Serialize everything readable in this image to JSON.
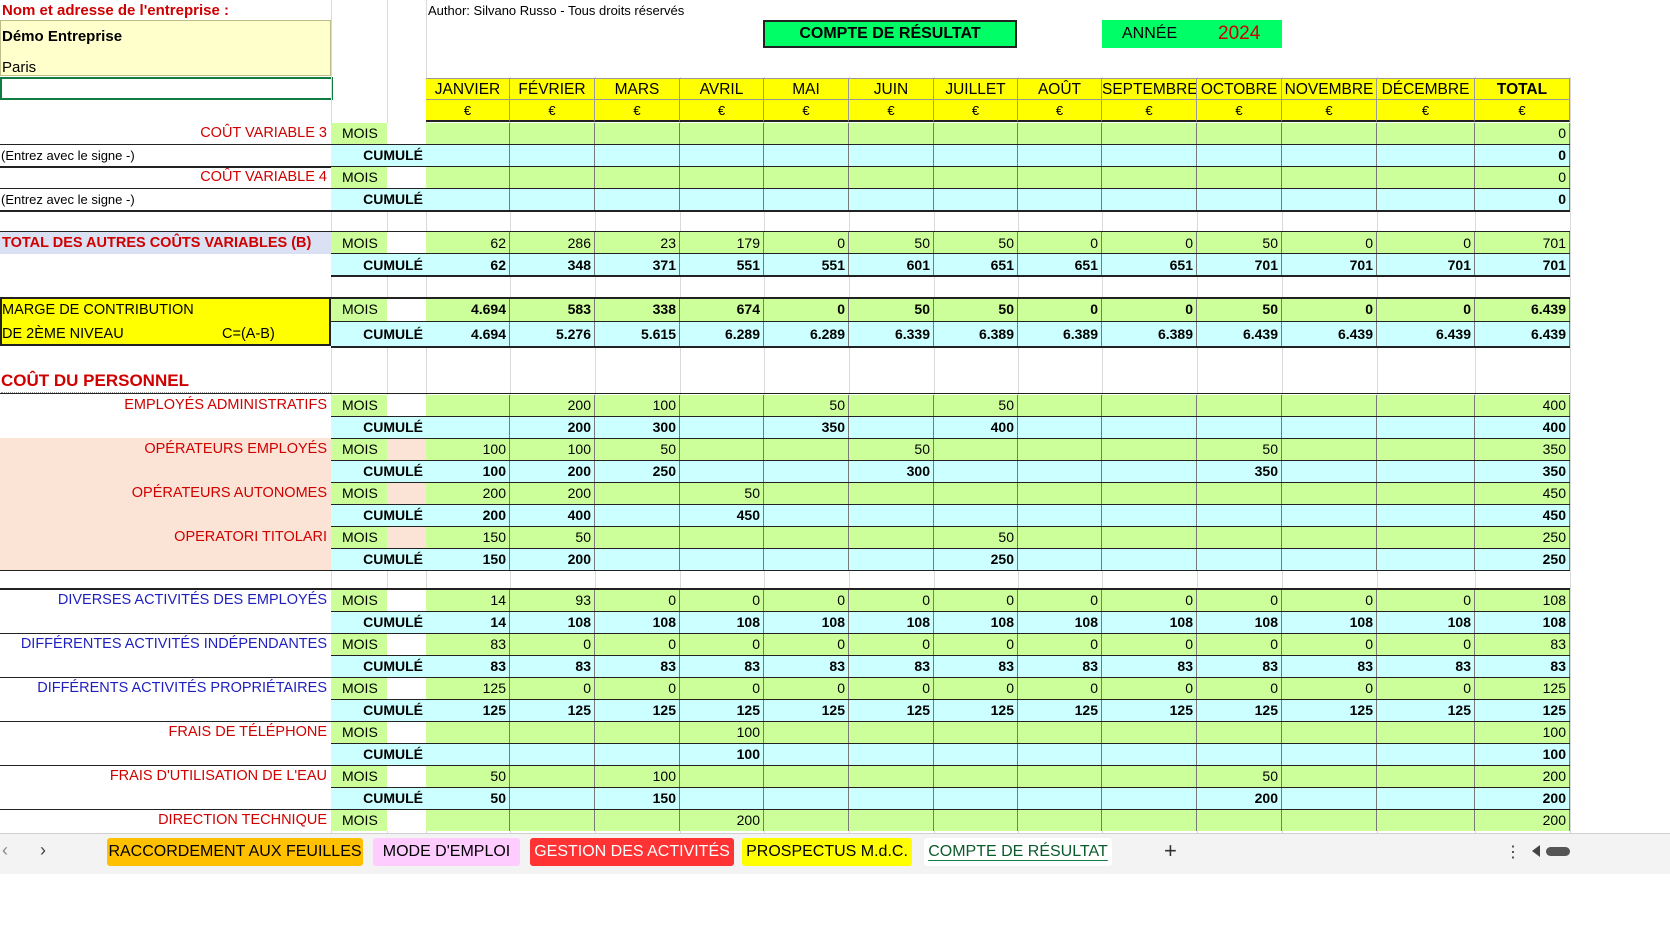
{
  "company": {
    "header": "Nom et adresse de l'entreprise :",
    "name": "Démo Entreprise",
    "city": "Paris"
  },
  "author": "Author: Silvano Russo - Tous droits réservés",
  "title": "COMPTE DE RÉSULTAT",
  "year_label": "ANNÉE",
  "year": "2024",
  "months": [
    "JANVIER",
    "FÉVRIER",
    "MARS",
    "AVRIL",
    "MAI",
    "JUIN",
    "JUILLET",
    "AOÛT",
    "SEPTEMBRE",
    "OCTOBRE",
    "NOVEMBRE",
    "DÉCEMBRE",
    "TOTAL"
  ],
  "currency": "€",
  "lbl_mois": "MOIS",
  "lbl_cumule": "CUMULÉ",
  "rows": {
    "cv3": {
      "label": "COÛT VARIABLE 3",
      "note": "(Entrez avec le signe -)",
      "mois": [
        "",
        "",
        "",
        "",
        "",
        "",
        "",
        "",
        "",
        "",
        "",
        "",
        "0"
      ],
      "cumule": [
        "",
        "",
        "",
        "",
        "",
        "",
        "",
        "",
        "",
        "",
        "",
        "",
        "0"
      ]
    },
    "cv4": {
      "label": "COÛT VARIABLE 4",
      "note": "(Entrez avec le signe -)",
      "mois": [
        "",
        "",
        "",
        "",
        "",
        "",
        "",
        "",
        "",
        "",
        "",
        "",
        "0"
      ],
      "cumule": [
        "",
        "",
        "",
        "",
        "",
        "",
        "",
        "",
        "",
        "",
        "",
        "",
        "0"
      ]
    },
    "tot": {
      "label": "TOTAL DES AUTRES COÛTS VARIABLES (B)",
      "mois": [
        "62",
        "286",
        "23",
        "179",
        "0",
        "50",
        "50",
        "0",
        "0",
        "50",
        "0",
        "0",
        "701"
      ],
      "cumule": [
        "62",
        "348",
        "371",
        "551",
        "551",
        "601",
        "651",
        "651",
        "651",
        "701",
        "701",
        "701",
        "701"
      ]
    },
    "marge": {
      "label1": "MARGE DE CONTRIBUTION",
      "label2": "DE 2ÈME NIVEAU",
      "formula": "C=(A-B)",
      "mois": [
        "4.694",
        "583",
        "338",
        "674",
        "0",
        "50",
        "50",
        "0",
        "0",
        "50",
        "0",
        "0",
        "6.439"
      ],
      "cumule": [
        "4.694",
        "5.276",
        "5.615",
        "6.289",
        "6.289",
        "6.339",
        "6.389",
        "6.389",
        "6.389",
        "6.439",
        "6.439",
        "6.439",
        "6.439"
      ]
    },
    "personnel_title": "COÛT DU PERSONNEL",
    "emp_admin": {
      "label": "EMPLOYÉS ADMINISTRATIFS",
      "mois": [
        "",
        "200",
        "100",
        "",
        "50",
        "",
        "50",
        "",
        "",
        "",
        "",
        "",
        "400"
      ],
      "cumule": [
        "",
        "200",
        "300",
        "",
        "350",
        "",
        "400",
        "",
        "",
        "",
        "",
        "",
        "400"
      ]
    },
    "op_emp": {
      "label": "OPÉRATEURS EMPLOYÉS",
      "mois": [
        "100",
        "100",
        "50",
        "",
        "",
        "50",
        "",
        "",
        "",
        "50",
        "",
        "",
        "350"
      ],
      "cumule": [
        "100",
        "200",
        "250",
        "",
        "",
        "300",
        "",
        "",
        "",
        "350",
        "",
        "",
        "350"
      ]
    },
    "op_auto": {
      "label": "OPÉRATEURS AUTONOMES",
      "mois": [
        "200",
        "200",
        "",
        "50",
        "",
        "",
        "",
        "",
        "",
        "",
        "",
        "",
        "450"
      ],
      "cumule": [
        "200",
        "400",
        "",
        "450",
        "",
        "",
        "",
        "",
        "",
        "",
        "",
        "",
        "450"
      ]
    },
    "op_tit": {
      "label": "OPERATORI TITOLARI",
      "mois": [
        "150",
        "50",
        "",
        "",
        "",
        "",
        "50",
        "",
        "",
        "",
        "",
        "",
        "250"
      ],
      "cumule": [
        "150",
        "200",
        "",
        "",
        "",
        "",
        "250",
        "",
        "",
        "",
        "",
        "",
        "250"
      ]
    },
    "div_emp": {
      "label": "DIVERSES ACTIVITÉS DES EMPLOYÉS",
      "mois": [
        "14",
        "93",
        "0",
        "0",
        "0",
        "0",
        "0",
        "0",
        "0",
        "0",
        "0",
        "0",
        "108"
      ],
      "cumule": [
        "14",
        "108",
        "108",
        "108",
        "108",
        "108",
        "108",
        "108",
        "108",
        "108",
        "108",
        "108",
        "108"
      ]
    },
    "diff_ind": {
      "label": "DIFFÉRENTES ACTIVITÉS INDÉPENDANTES",
      "mois": [
        "83",
        "0",
        "0",
        "0",
        "0",
        "0",
        "0",
        "0",
        "0",
        "0",
        "0",
        "0",
        "83"
      ],
      "cumule": [
        "83",
        "83",
        "83",
        "83",
        "83",
        "83",
        "83",
        "83",
        "83",
        "83",
        "83",
        "83",
        "83"
      ]
    },
    "diff_prop": {
      "label": "DIFFÉRENTS ACTIVITÉS PROPRIÉTAIRES",
      "mois": [
        "125",
        "0",
        "0",
        "0",
        "0",
        "0",
        "0",
        "0",
        "0",
        "0",
        "0",
        "0",
        "125"
      ],
      "cumule": [
        "125",
        "125",
        "125",
        "125",
        "125",
        "125",
        "125",
        "125",
        "125",
        "125",
        "125",
        "125",
        "125"
      ]
    },
    "tel": {
      "label": "FRAIS DE TÉLÉPHONE",
      "mois": [
        "",
        "",
        "",
        "100",
        "",
        "",
        "",
        "",
        "",
        "",
        "",
        "",
        "100"
      ],
      "cumule": [
        "",
        "",
        "",
        "100",
        "",
        "",
        "",
        "",
        "",
        "",
        "",
        "",
        "100"
      ]
    },
    "eau": {
      "label": "FRAIS D'UTILISATION DE L'EAU",
      "mois": [
        "50",
        "",
        "100",
        "",
        "",
        "",
        "",
        "",
        "",
        "50",
        "",
        "",
        "200"
      ],
      "cumule": [
        "50",
        "",
        "150",
        "",
        "",
        "",
        "",
        "",
        "",
        "200",
        "",
        "",
        "200"
      ]
    },
    "dir": {
      "label": "DIRECTION TECHNIQUE",
      "mois": [
        "",
        "",
        "",
        "200",
        "",
        "",
        "",
        "",
        "",
        "",
        "",
        "",
        "200"
      ]
    }
  },
  "tabs": [
    "RACCORDEMENT AUX FEUILLES",
    "MODE D'EMPLOI",
    "GESTION DES ACTIVITÉS",
    "PROSPECTUS M.d.C.",
    "COMPTE DE RÉSULTAT"
  ],
  "colors": {
    "green": "#ccff99",
    "cyan": "#ccffff",
    "yellow": "#ffff00",
    "bright_green": "#00ff66",
    "red": "#d00000",
    "blue": "#1f1fbf",
    "pink": "#fbe3d6"
  }
}
